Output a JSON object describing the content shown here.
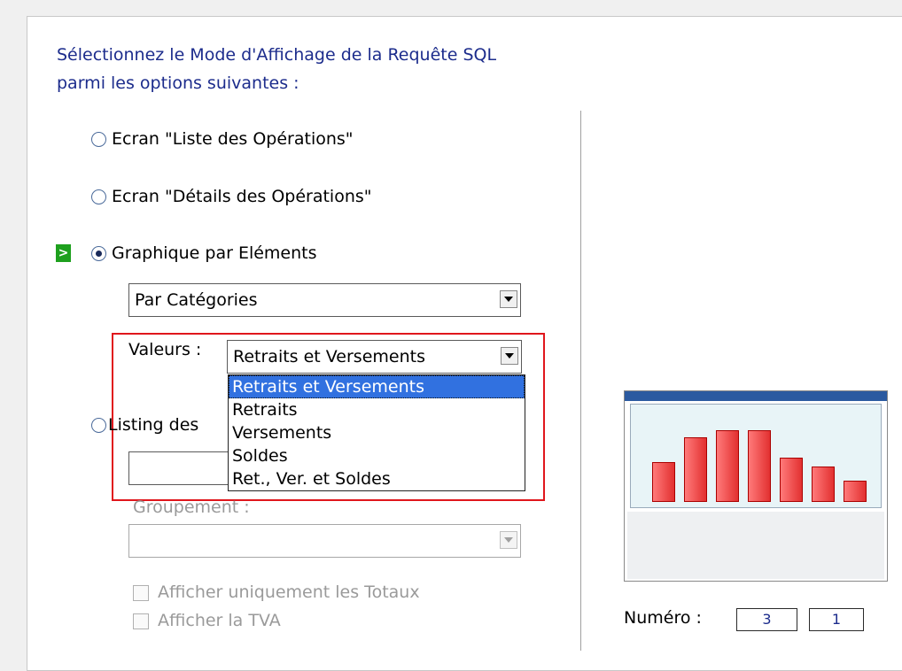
{
  "header": {
    "title_line1": "Sélectionnez le Mode d'Affichage de la Requête SQL",
    "title_line2": "parmi les options suivantes :"
  },
  "options": [
    {
      "label": "Ecran \"Liste des Opérations\"",
      "selected": false
    },
    {
      "label": "Ecran \"Détails des Opérations\"",
      "selected": false
    },
    {
      "label": "Graphique par Eléments",
      "selected": true
    },
    {
      "label": "Listing des",
      "selected": false
    }
  ],
  "arrow_indicator": ">",
  "graph": {
    "category_combo_value": "Par Catégories",
    "values_label": "Valeurs :",
    "values_combo_value": "Retraits et Versements",
    "values_options": [
      "Retraits et Versements",
      "Retraits",
      "Versements",
      "Soldes",
      "Ret., Ver. et Soldes"
    ],
    "values_selected_index": 0
  },
  "listing": {
    "field1_value": "",
    "groupement_label": "Groupement :",
    "groupement_value": ""
  },
  "checkboxes": [
    {
      "label": "Afficher uniquement les Totaux",
      "checked": false
    },
    {
      "label": "Afficher la TVA",
      "checked": false
    }
  ],
  "numero": {
    "label": "Numéro :",
    "value1": "3",
    "value2": "1"
  },
  "colors": {
    "title_text": "#1c2c8c",
    "highlight_box": "#e0161c",
    "selection": "#3171e0",
    "arrow_badge": "#1ea01e"
  },
  "preview": {
    "bar_values": [
      0.41,
      0.66,
      0.74,
      0.74,
      0.45,
      0.36,
      0.22
    ]
  }
}
